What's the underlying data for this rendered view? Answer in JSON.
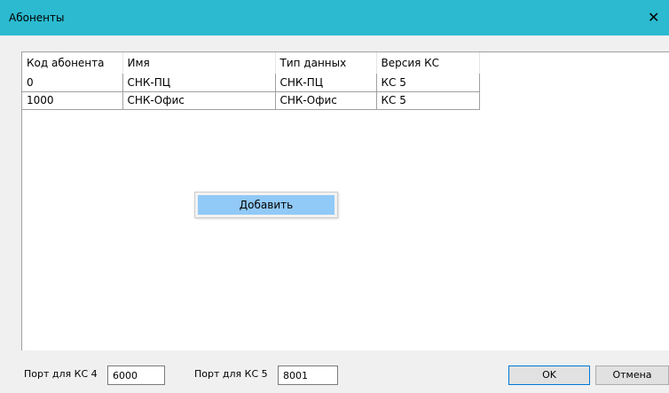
{
  "window": {
    "title": "Абоненты",
    "close_glyph": "✕",
    "title_bar_color": "#2bbad0"
  },
  "table": {
    "columns": [
      "Код абонента",
      "Имя",
      "Тип данных",
      "Версия КС"
    ],
    "rows": [
      [
        "0",
        "СНК-ПЦ",
        "СНК-ПЦ",
        "КС 5"
      ],
      [
        "1000",
        "СНК-Офис",
        "СНК-Офис",
        "КС 5"
      ]
    ]
  },
  "context_menu": {
    "items": [
      "Добавить"
    ],
    "highlight_color": "#91c9f7"
  },
  "footer": {
    "port_ks4_label": "Порт для КС 4",
    "port_ks4_value": "6000",
    "port_ks5_label": "Порт для КС 5",
    "port_ks5_value": "8001",
    "ok_label": "OK",
    "cancel_label": "Отмена"
  }
}
